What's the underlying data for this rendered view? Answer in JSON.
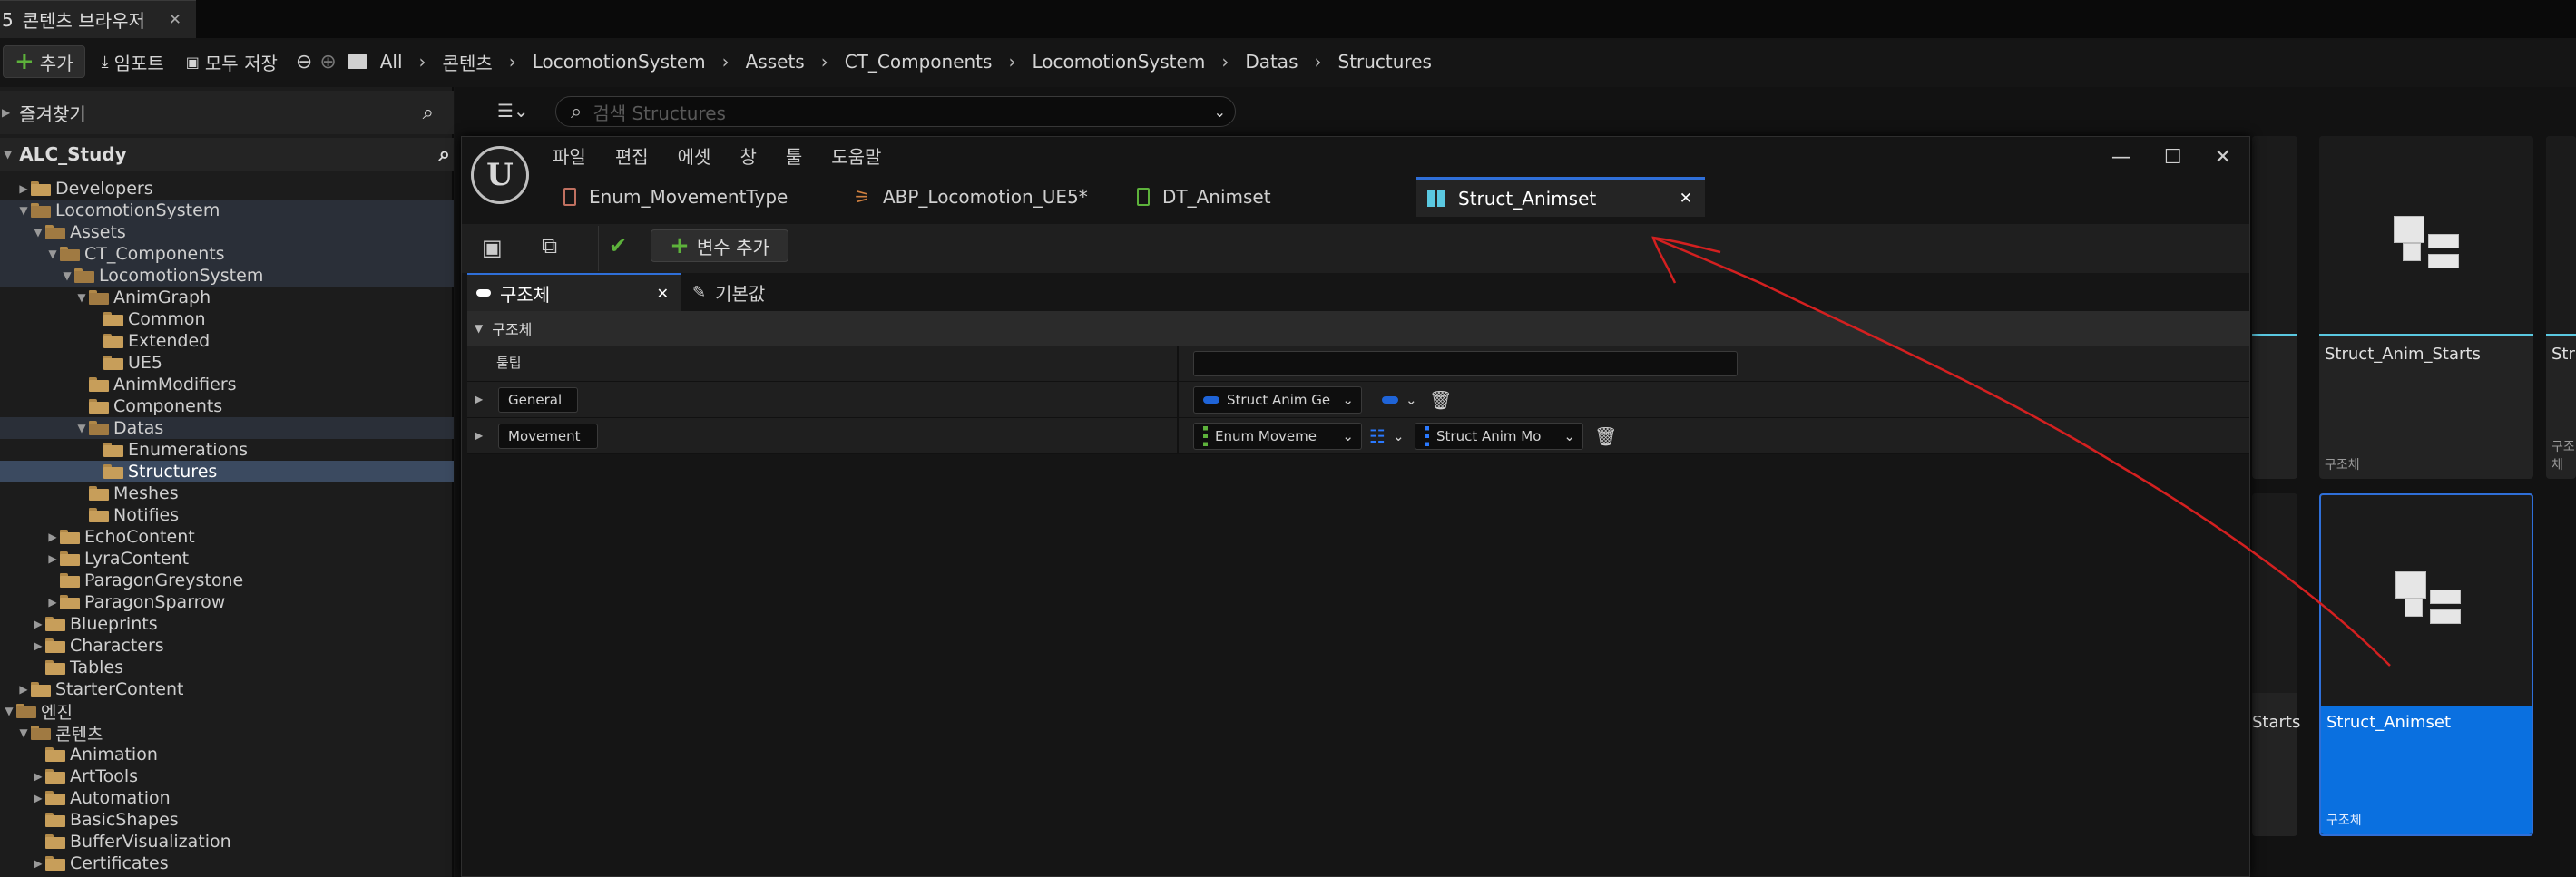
{
  "app": {
    "tab_title": "콘텐츠 브라우저",
    "tab_prefix": "5"
  },
  "toolbar": {
    "add_label": "추가",
    "import_label": "임포트",
    "save_all_label": "모두 저장",
    "breadcrumb": [
      "All",
      "콘텐츠",
      "LocomotionSystem",
      "Assets",
      "CT_Components",
      "LocomotionSystem",
      "Datas",
      "Structures"
    ]
  },
  "left_panel": {
    "favorites_label": "즐겨찾기",
    "project_name": "ALC_Study",
    "tree": [
      {
        "label": "Developers",
        "arrow": "▶",
        "open": false
      },
      {
        "label": "LocomotionSystem",
        "arrow": "▼",
        "open": true
      },
      {
        "label": "Assets",
        "arrow": "▼",
        "open": true
      },
      {
        "label": "CT_Components",
        "arrow": "▼",
        "open": true
      },
      {
        "label": "LocomotionSystem",
        "arrow": "▼",
        "open": true
      },
      {
        "label": "AnimGraph",
        "arrow": "▼",
        "open": true
      },
      {
        "label": "Common",
        "arrow": "",
        "open": false
      },
      {
        "label": "Extended",
        "arrow": "",
        "open": false
      },
      {
        "label": "UE5",
        "arrow": "",
        "open": false
      },
      {
        "label": "AnimModifiers",
        "arrow": "",
        "open": false
      },
      {
        "label": "Components",
        "arrow": "",
        "open": false
      },
      {
        "label": "Datas",
        "arrow": "▼",
        "open": true
      },
      {
        "label": "Enumerations",
        "arrow": "",
        "open": false
      },
      {
        "label": "Structures",
        "arrow": "",
        "open": false
      },
      {
        "label": "Meshes",
        "arrow": "",
        "open": false
      },
      {
        "label": "Notifies",
        "arrow": "",
        "open": false
      },
      {
        "label": "EchoContent",
        "arrow": "▶",
        "open": false
      },
      {
        "label": "LyraContent",
        "arrow": "▶",
        "open": false
      },
      {
        "label": "ParagonGreystone",
        "arrow": "",
        "open": false
      },
      {
        "label": "ParagonSparrow",
        "arrow": "▶",
        "open": false
      },
      {
        "label": "Blueprints",
        "arrow": "▶",
        "open": false
      },
      {
        "label": "Characters",
        "arrow": "▶",
        "open": false
      },
      {
        "label": "Tables",
        "arrow": "",
        "open": false
      },
      {
        "label": "StarterContent",
        "arrow": "▶",
        "open": false
      },
      {
        "label": "엔진",
        "arrow": "▼",
        "open": true
      },
      {
        "label": "콘텐츠",
        "arrow": "▼",
        "open": true
      },
      {
        "label": "Animation",
        "arrow": "",
        "open": false
      },
      {
        "label": "ArtTools",
        "arrow": "▶",
        "open": false
      },
      {
        "label": "Automation",
        "arrow": "▶",
        "open": false
      },
      {
        "label": "BasicShapes",
        "arrow": "",
        "open": false
      },
      {
        "label": "BufferVisualization",
        "arrow": "",
        "open": false
      },
      {
        "label": "Certificates",
        "arrow": "▶",
        "open": false
      }
    ]
  },
  "search": {
    "placeholder": "검색 Structures"
  },
  "assets": [
    {
      "name": "Struct_Anim_Starts",
      "kind": "구조체"
    },
    {
      "name": "Struct_Animset",
      "kind": "구조체"
    },
    {
      "name": "Str",
      "kind": "구조체"
    },
    {
      "name": "Starts",
      "kind": ""
    }
  ],
  "editor": {
    "menu": [
      "파일",
      "편집",
      "에셋",
      "창",
      "툴",
      "도움말"
    ],
    "tabs": [
      {
        "label": "Enum_MovementType"
      },
      {
        "label": "ABP_Locomotion_UE5*"
      },
      {
        "label": "DT_Animset"
      },
      {
        "label": "Struct_Animset"
      }
    ],
    "add_variable_label": "변수 추가",
    "subtabs": [
      "구조체",
      "기본값"
    ],
    "section_label": "구조체",
    "tooltip_label": "툴팁",
    "members": [
      {
        "name": "General",
        "type": "Struct Anim Ge"
      },
      {
        "name": "Movement",
        "type": "Enum Moveme",
        "value_type": "Struct Anim Mo"
      }
    ]
  },
  "colors": {
    "accent": "#2f6fd8",
    "selected_tile": "#0a70e0",
    "annotation": "#d42020"
  }
}
